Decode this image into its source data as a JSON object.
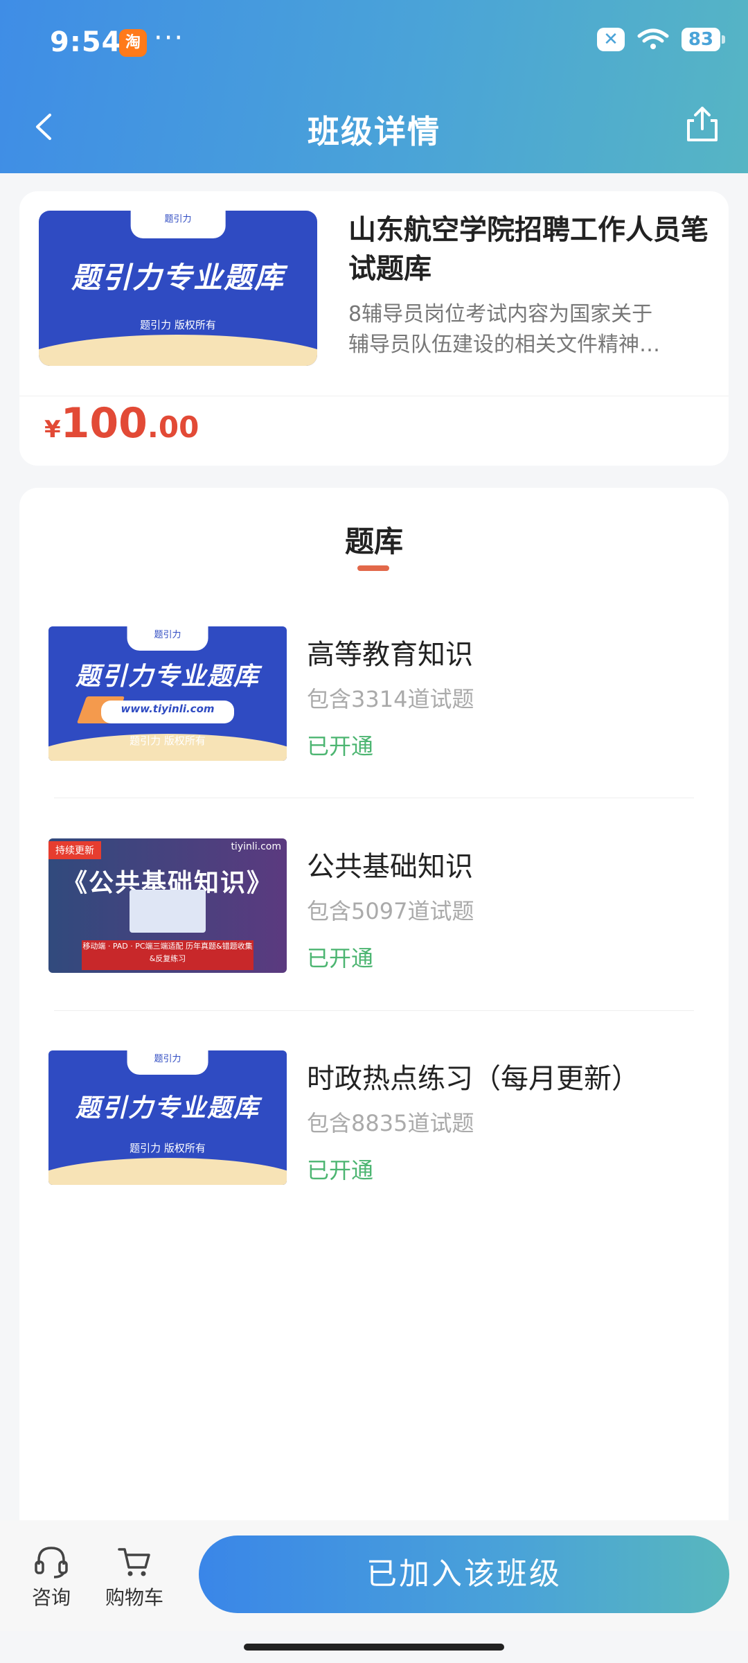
{
  "status_bar": {
    "time": "9:54",
    "app_badge": "淘",
    "more": "···",
    "battery": "83"
  },
  "nav": {
    "title": "班级详情"
  },
  "course": {
    "thumb_tag": "题引力",
    "thumb_main": "题引力专业题库",
    "thumb_sub": "题引力 版权所有",
    "title": "山东航空学院招聘工作人员笔试题库",
    "desc_line1": "8辅导员岗位考试内容为国家关于",
    "desc_line2": "辅导员队伍建设的相关文件精神…",
    "price_symbol": "¥",
    "price_int": "100",
    "price_dec": ".00"
  },
  "bank_section": {
    "title": "题库",
    "items": [
      {
        "thumb_tag": "题引力",
        "thumb_main": "题引力专业题库",
        "thumb_url": "www.tiyinli.com",
        "thumb_sub": "题引力 版权所有",
        "name": "高等教育知识",
        "count": "包含3314道试题",
        "status": "已开通"
      },
      {
        "thumb_ribbon": "持续更新",
        "thumb_brand": "tiyinli.com",
        "thumb_main": "《公共基础知识》",
        "thumb_banner": "移动端 · PAD · PC端三端适配 历年真题&错题收集&反复练习",
        "name": "公共基础知识",
        "count": "包含5097道试题",
        "status": "已开通"
      },
      {
        "thumb_tag": "题引力",
        "thumb_main": "题引力专业题库",
        "thumb_sub": "题引力 版权所有",
        "name": "时政热点练习（每月更新）",
        "count": "包含8835道试题",
        "status": "已开通"
      }
    ]
  },
  "bottom_bar": {
    "consult_label": "咨询",
    "cart_label": "购物车",
    "join_label": "已加入该班级"
  }
}
